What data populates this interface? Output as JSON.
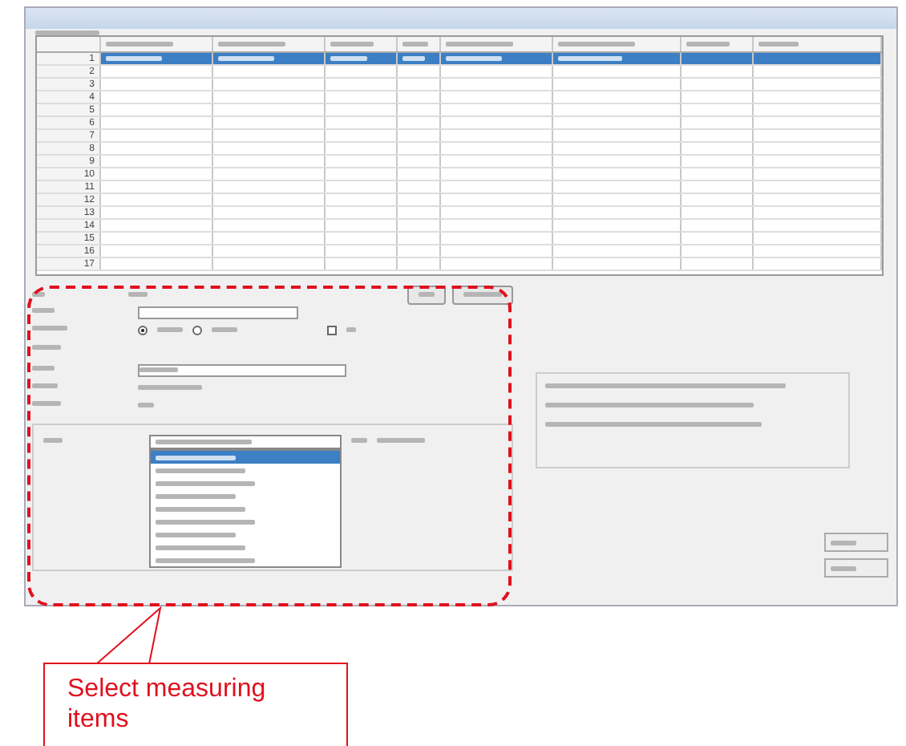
{
  "grid": {
    "rows": [
      {
        "number": "1",
        "selected": true
      },
      {
        "number": "2",
        "selected": false
      },
      {
        "number": "3",
        "selected": false
      },
      {
        "number": "4",
        "selected": false
      },
      {
        "number": "5",
        "selected": false
      },
      {
        "number": "6",
        "selected": false
      },
      {
        "number": "7",
        "selected": false
      },
      {
        "number": "8",
        "selected": false
      },
      {
        "number": "9",
        "selected": false
      },
      {
        "number": "10",
        "selected": false
      },
      {
        "number": "11",
        "selected": false
      },
      {
        "number": "12",
        "selected": false
      },
      {
        "number": "13",
        "selected": false
      },
      {
        "number": "14",
        "selected": false
      },
      {
        "number": "15",
        "selected": false
      },
      {
        "number": "16",
        "selected": false
      },
      {
        "number": "17",
        "selected": false
      }
    ]
  },
  "form": {
    "radios": [
      {
        "checked": true
      },
      {
        "checked": false
      }
    ],
    "checkbox": {
      "checked": false
    }
  },
  "dropdown": {
    "expanded": true,
    "items": [
      {
        "selected": true
      },
      {
        "selected": false
      },
      {
        "selected": false
      },
      {
        "selected": false
      },
      {
        "selected": false
      },
      {
        "selected": false
      },
      {
        "selected": false
      },
      {
        "selected": false
      },
      {
        "selected": false
      }
    ]
  },
  "callout": {
    "text": "Select measuring items"
  }
}
